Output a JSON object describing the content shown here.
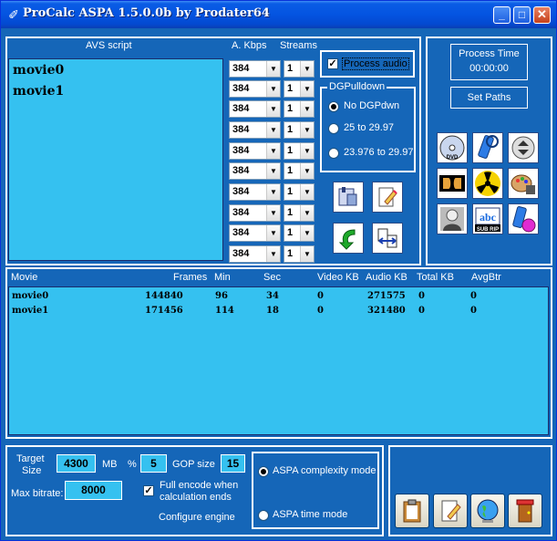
{
  "window": {
    "title": "ProCalc ASPA 1.5.0.0b by Prodater64",
    "min": "_",
    "max": "□",
    "close": "✕"
  },
  "avs": {
    "header": "AVS script",
    "lines": [
      "movie0",
      "movie1"
    ]
  },
  "audio": {
    "kbps_header": "A. Kbps",
    "streams_header": "Streams",
    "rows": [
      {
        "kbps": "384",
        "streams": "1"
      },
      {
        "kbps": "384",
        "streams": "1"
      },
      {
        "kbps": "384",
        "streams": "1"
      },
      {
        "kbps": "384",
        "streams": "1"
      },
      {
        "kbps": "384",
        "streams": "1"
      },
      {
        "kbps": "384",
        "streams": "1"
      },
      {
        "kbps": "384",
        "streams": "1"
      },
      {
        "kbps": "384",
        "streams": "1"
      },
      {
        "kbps": "384",
        "streams": "1"
      },
      {
        "kbps": "384",
        "streams": "1"
      }
    ]
  },
  "process_audio": {
    "label": "Process audio",
    "checked": true
  },
  "pulldown": {
    "title": "DGPulldown",
    "options": [
      {
        "label": "No DGPdwn",
        "selected": true
      },
      {
        "label": "25 to 29.97",
        "selected": false
      },
      {
        "label": "23.976 to 29.97",
        "selected": false
      }
    ]
  },
  "process_time": {
    "label": "Process Time",
    "value": "00:00:00"
  },
  "set_paths": "Set Paths",
  "table": {
    "headers": [
      "Movie",
      "Frames",
      "Min",
      "Sec",
      "Video KB",
      "Audio KB",
      "Total KB",
      "AvgBtr"
    ],
    "rows": [
      [
        "movie0",
        "144840",
        "96",
        "34",
        "0",
        "271575",
        "0",
        "0"
      ],
      [
        "movie1",
        "171456",
        "114",
        "18",
        "0",
        "321480",
        "0",
        "0"
      ]
    ]
  },
  "bottom": {
    "target_size_label_1": "Target",
    "target_size_label_2": "Size",
    "target_size": "4300",
    "mb": "MB",
    "percent_sign": "%",
    "percent": "5",
    "gop_label": "GOP size",
    "gop": "15",
    "max_bitrate_label": "Max bitrate:",
    "max_bitrate": "8000",
    "full_encode_1": "Full encode when",
    "full_encode_2": "calculation ends",
    "configure": "Configure engine",
    "mode_complexity": "ASPA complexity mode",
    "mode_time": "ASPA time mode"
  },
  "icons": {
    "dvd_label": "DVD",
    "sub_rip_label": "SUB RIP",
    "sub_abc": "abc"
  },
  "colors": {
    "window_blue": "#1566b8",
    "cyan": "#35c1f0",
    "title_blue": "#0454e1"
  }
}
